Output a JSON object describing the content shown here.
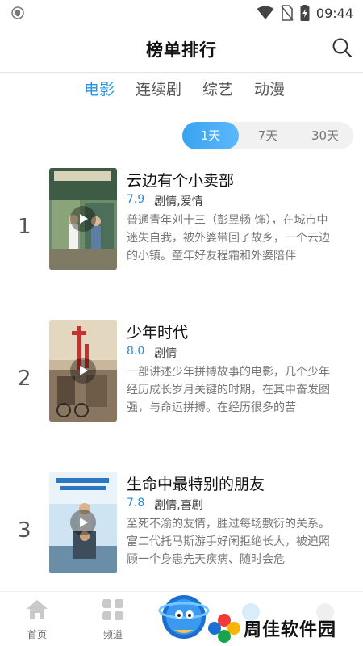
{
  "status_bar": {
    "time": "09:44"
  },
  "header": {
    "title": "榜单排行"
  },
  "category_tabs": [
    {
      "label": "电影",
      "active": true
    },
    {
      "label": "连续剧",
      "active": false
    },
    {
      "label": "综艺",
      "active": false
    },
    {
      "label": "动漫",
      "active": false
    }
  ],
  "period_toggle": {
    "options": [
      "1天",
      "7天",
      "30天"
    ],
    "selected": "1天"
  },
  "list": [
    {
      "rank": "1",
      "name": "云边有个小卖部",
      "score": "7.9",
      "genre": "剧情,爱情",
      "description": "普通青年刘十三（彭昱畅 饰），在城市中迷失自我，被外婆带回了故乡，一个云边的小镇。童年好友程霜和外婆陪伴"
    },
    {
      "rank": "2",
      "name": "少年时代",
      "score": "8.0",
      "genre": "剧情",
      "description": "一部讲述少年拼搏故事的电影，几个少年经历成长岁月关键的时期，在其中奋发图强，与命运拼搏。在经历很多的苦"
    },
    {
      "rank": "3",
      "name": "生命中最特别的朋友",
      "score": "7.8",
      "genre": "剧情,喜剧",
      "description": "至死不渝的友情，胜过每场敷衍的关系。富二代托马斯游手好闲拒绝长大，被迫照顾一个身患先天疾病、随时会危"
    }
  ],
  "bottom_nav": {
    "home": "首页",
    "channel": "频道"
  },
  "watermark": {
    "text": "周佳软件园"
  },
  "colors": {
    "accent": "#2196e8",
    "score": "#2a8fd8"
  }
}
